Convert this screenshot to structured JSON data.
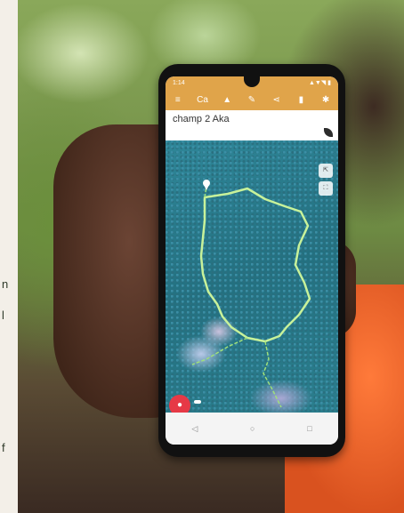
{
  "page": {
    "left_fragments": [
      "n",
      "l",
      "f"
    ]
  },
  "phone": {
    "status_time": "1:14",
    "status_icons": "▲▼◥ ▮",
    "toolbar_icons": [
      {
        "name": "menu-icon",
        "glyph": "≡"
      },
      {
        "name": "layers-icon",
        "glyph": "Ca"
      },
      {
        "name": "flask-icon",
        "glyph": "▲"
      },
      {
        "name": "pencil-icon",
        "glyph": "✎"
      },
      {
        "name": "share-icon",
        "glyph": "⋖"
      },
      {
        "name": "trash-icon",
        "glyph": "▮"
      },
      {
        "name": "settings-icon",
        "glyph": "✱"
      }
    ],
    "title": "champ 2 Aka",
    "subtitle": "",
    "map_buttons": [
      "⇱",
      "⛶"
    ],
    "action_label": "",
    "nav": [
      "◁",
      "○",
      "□"
    ]
  }
}
